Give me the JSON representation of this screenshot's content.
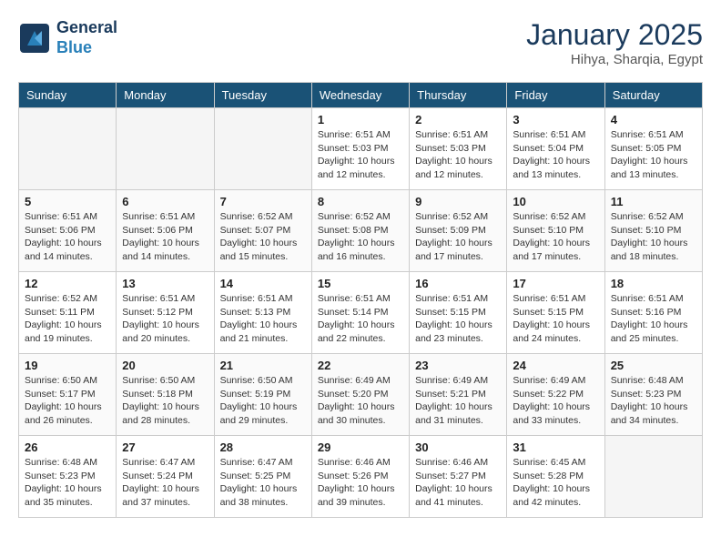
{
  "header": {
    "logo_line1": "General",
    "logo_line2": "Blue",
    "title": "January 2025",
    "subtitle": "Hihya, Sharqia, Egypt"
  },
  "days_of_week": [
    "Sunday",
    "Monday",
    "Tuesday",
    "Wednesday",
    "Thursday",
    "Friday",
    "Saturday"
  ],
  "weeks": [
    [
      {
        "day": "",
        "info": ""
      },
      {
        "day": "",
        "info": ""
      },
      {
        "day": "",
        "info": ""
      },
      {
        "day": "1",
        "info": "Sunrise: 6:51 AM\nSunset: 5:03 PM\nDaylight: 10 hours\nand 12 minutes."
      },
      {
        "day": "2",
        "info": "Sunrise: 6:51 AM\nSunset: 5:03 PM\nDaylight: 10 hours\nand 12 minutes."
      },
      {
        "day": "3",
        "info": "Sunrise: 6:51 AM\nSunset: 5:04 PM\nDaylight: 10 hours\nand 13 minutes."
      },
      {
        "day": "4",
        "info": "Sunrise: 6:51 AM\nSunset: 5:05 PM\nDaylight: 10 hours\nand 13 minutes."
      }
    ],
    [
      {
        "day": "5",
        "info": "Sunrise: 6:51 AM\nSunset: 5:06 PM\nDaylight: 10 hours\nand 14 minutes."
      },
      {
        "day": "6",
        "info": "Sunrise: 6:51 AM\nSunset: 5:06 PM\nDaylight: 10 hours\nand 14 minutes."
      },
      {
        "day": "7",
        "info": "Sunrise: 6:52 AM\nSunset: 5:07 PM\nDaylight: 10 hours\nand 15 minutes."
      },
      {
        "day": "8",
        "info": "Sunrise: 6:52 AM\nSunset: 5:08 PM\nDaylight: 10 hours\nand 16 minutes."
      },
      {
        "day": "9",
        "info": "Sunrise: 6:52 AM\nSunset: 5:09 PM\nDaylight: 10 hours\nand 17 minutes."
      },
      {
        "day": "10",
        "info": "Sunrise: 6:52 AM\nSunset: 5:10 PM\nDaylight: 10 hours\nand 17 minutes."
      },
      {
        "day": "11",
        "info": "Sunrise: 6:52 AM\nSunset: 5:10 PM\nDaylight: 10 hours\nand 18 minutes."
      }
    ],
    [
      {
        "day": "12",
        "info": "Sunrise: 6:52 AM\nSunset: 5:11 PM\nDaylight: 10 hours\nand 19 minutes."
      },
      {
        "day": "13",
        "info": "Sunrise: 6:51 AM\nSunset: 5:12 PM\nDaylight: 10 hours\nand 20 minutes."
      },
      {
        "day": "14",
        "info": "Sunrise: 6:51 AM\nSunset: 5:13 PM\nDaylight: 10 hours\nand 21 minutes."
      },
      {
        "day": "15",
        "info": "Sunrise: 6:51 AM\nSunset: 5:14 PM\nDaylight: 10 hours\nand 22 minutes."
      },
      {
        "day": "16",
        "info": "Sunrise: 6:51 AM\nSunset: 5:15 PM\nDaylight: 10 hours\nand 23 minutes."
      },
      {
        "day": "17",
        "info": "Sunrise: 6:51 AM\nSunset: 5:15 PM\nDaylight: 10 hours\nand 24 minutes."
      },
      {
        "day": "18",
        "info": "Sunrise: 6:51 AM\nSunset: 5:16 PM\nDaylight: 10 hours\nand 25 minutes."
      }
    ],
    [
      {
        "day": "19",
        "info": "Sunrise: 6:50 AM\nSunset: 5:17 PM\nDaylight: 10 hours\nand 26 minutes."
      },
      {
        "day": "20",
        "info": "Sunrise: 6:50 AM\nSunset: 5:18 PM\nDaylight: 10 hours\nand 28 minutes."
      },
      {
        "day": "21",
        "info": "Sunrise: 6:50 AM\nSunset: 5:19 PM\nDaylight: 10 hours\nand 29 minutes."
      },
      {
        "day": "22",
        "info": "Sunrise: 6:49 AM\nSunset: 5:20 PM\nDaylight: 10 hours\nand 30 minutes."
      },
      {
        "day": "23",
        "info": "Sunrise: 6:49 AM\nSunset: 5:21 PM\nDaylight: 10 hours\nand 31 minutes."
      },
      {
        "day": "24",
        "info": "Sunrise: 6:49 AM\nSunset: 5:22 PM\nDaylight: 10 hours\nand 33 minutes."
      },
      {
        "day": "25",
        "info": "Sunrise: 6:48 AM\nSunset: 5:23 PM\nDaylight: 10 hours\nand 34 minutes."
      }
    ],
    [
      {
        "day": "26",
        "info": "Sunrise: 6:48 AM\nSunset: 5:23 PM\nDaylight: 10 hours\nand 35 minutes."
      },
      {
        "day": "27",
        "info": "Sunrise: 6:47 AM\nSunset: 5:24 PM\nDaylight: 10 hours\nand 37 minutes."
      },
      {
        "day": "28",
        "info": "Sunrise: 6:47 AM\nSunset: 5:25 PM\nDaylight: 10 hours\nand 38 minutes."
      },
      {
        "day": "29",
        "info": "Sunrise: 6:46 AM\nSunset: 5:26 PM\nDaylight: 10 hours\nand 39 minutes."
      },
      {
        "day": "30",
        "info": "Sunrise: 6:46 AM\nSunset: 5:27 PM\nDaylight: 10 hours\nand 41 minutes."
      },
      {
        "day": "31",
        "info": "Sunrise: 6:45 AM\nSunset: 5:28 PM\nDaylight: 10 hours\nand 42 minutes."
      },
      {
        "day": "",
        "info": ""
      }
    ]
  ]
}
